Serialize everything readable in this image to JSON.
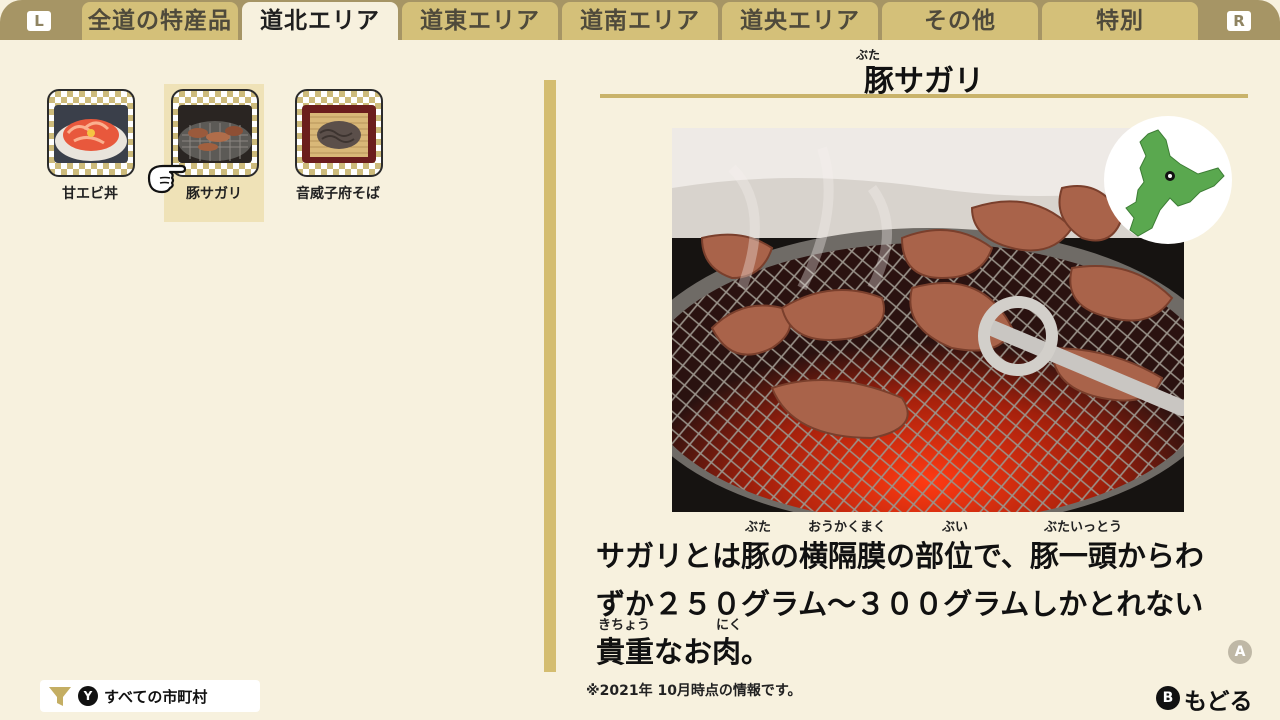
{
  "shoulders": {
    "left": "L",
    "right": "R"
  },
  "tabs": [
    {
      "label": "全道の特産品",
      "active": false
    },
    {
      "label": "道北エリア",
      "active": true
    },
    {
      "label": "道東エリア",
      "active": false
    },
    {
      "label": "道南エリア",
      "active": false
    },
    {
      "label": "道央エリア",
      "active": false
    },
    {
      "label": "その他",
      "active": false
    },
    {
      "label": "特別",
      "active": false
    }
  ],
  "items": [
    {
      "label": "甘エビ丼",
      "selected": false
    },
    {
      "label": "豚サガリ",
      "selected": true
    },
    {
      "label": "音威子府そば",
      "selected": false
    }
  ],
  "detail": {
    "title_ruby": "ぶた",
    "title": "豚サガリ",
    "description_lines": [
      "サガリとは豚の横隔膜の部位で、豚一頭からわ",
      "ずか２５０グラム〜３００グラムしかとれない",
      "貴重なお肉。"
    ],
    "furigana": [
      {
        "text": "ぶた"
      },
      {
        "text": "おうかくまく"
      },
      {
        "text": "ぶい"
      },
      {
        "text": "ぶたいっとう"
      },
      {
        "text": "きちょう"
      },
      {
        "text": "にく"
      }
    ],
    "note": "※2021年 10月時点の情報です。"
  },
  "footer": {
    "filter_button": "Y",
    "filter_label": "すべての市町村",
    "a_button": "A",
    "back_button": "B",
    "back_label": "もどる"
  },
  "colors": {
    "background": "#f7f1de",
    "tabbar": "#a69565",
    "tab": "#d4c079",
    "accent": "#d4bd70",
    "map_land": "#5aa84f"
  },
  "icons": {
    "filter": "funnel-icon",
    "pointer": "pointing-hand-icon",
    "map": "hokkaido-map-icon"
  }
}
